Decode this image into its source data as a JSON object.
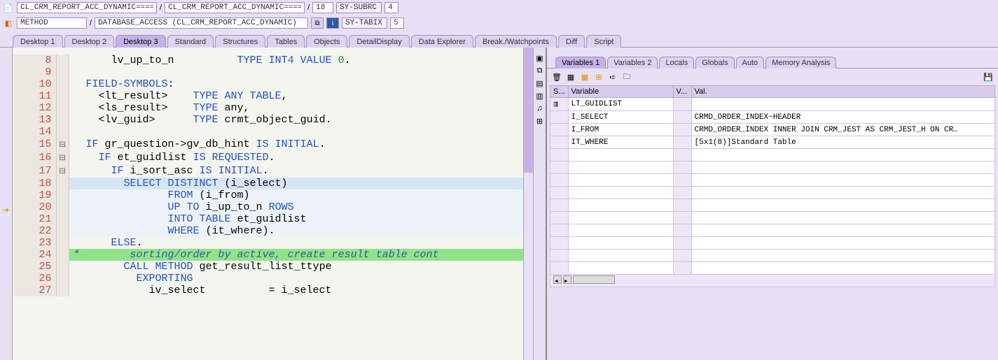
{
  "topbar": {
    "field1": "CL_CRM_REPORT_ACC_DYNAMIC====",
    "slash": "/",
    "field2": "CL_CRM_REPORT_ACC_DYNAMIC====",
    "field3": "18",
    "subrc_label": "SY-SUBRC",
    "subrc_val": "4"
  },
  "secbar": {
    "field1": "METHOD",
    "slash": "/",
    "field2": "DATABASE_ACCESS (CL_CRM_REPORT_ACC_DYNAMIC)",
    "tabix_label": "SY-TABIX",
    "tabix_val": "5"
  },
  "maintabs": [
    {
      "label": "Desktop 1"
    },
    {
      "label": "Desktop 2"
    },
    {
      "label": "Desktop 3",
      "active": true
    },
    {
      "label": "Standard"
    },
    {
      "label": "Structures"
    },
    {
      "label": "Tables"
    },
    {
      "label": "Objects"
    },
    {
      "label": "DetailDisplay"
    },
    {
      "label": "Data Explorer"
    },
    {
      "label": "Break./Watchpoints"
    },
    {
      "label": "Diff"
    },
    {
      "label": "Script"
    }
  ],
  "code": [
    {
      "n": 8,
      "g": "",
      "html": "      lv_up_to_n          <span class='kw'>TYPE</span> <span class='kw'>INT4</span> <span class='kw'>VALUE</span> <span class='num'>0</span>."
    },
    {
      "n": 9,
      "g": "",
      "html": ""
    },
    {
      "n": 10,
      "g": "",
      "html": "  <span class='kw'>FIELD-SYMBOLS</span>:"
    },
    {
      "n": 11,
      "g": "",
      "html": "    &lt;lt_result&gt;    <span class='kw'>TYPE ANY TABLE</span>,"
    },
    {
      "n": 12,
      "g": "",
      "html": "    &lt;ls_result&gt;    <span class='kw'>TYPE</span> any,"
    },
    {
      "n": 13,
      "g": "",
      "html": "    &lt;lv_guid&gt;      <span class='kw'>TYPE</span> crmt_object_guid."
    },
    {
      "n": 14,
      "g": "",
      "html": ""
    },
    {
      "n": 15,
      "g": "⊟",
      "html": "  <span class='kw'>IF</span> gr_question-&gt;gv_db_hint <span class='kw'>IS INITIAL</span>."
    },
    {
      "n": 16,
      "g": "⊟",
      "html": "    <span class='kw'>IF</span> et_guidlist <span class='kw'>IS REQUESTED</span>."
    },
    {
      "n": 17,
      "g": "⊟",
      "html": "      <span class='kw'>IF</span> i_sort_asc <span class='kw'>IS INITIAL</span>."
    },
    {
      "n": 18,
      "g": "",
      "cur": true,
      "html": "        <span class='kw'>SELECT DISTINCT</span> (i_select)"
    },
    {
      "n": 19,
      "g": "",
      "hl": true,
      "html": "               <span class='kw'>FROM</span> (i_from)"
    },
    {
      "n": 20,
      "g": "",
      "hl": true,
      "html": "               <span class='kw'>UP TO</span> i_up_to_n <span class='kw'>ROWS</span>"
    },
    {
      "n": 21,
      "g": "",
      "hl": true,
      "html": "               <span class='kw'>INTO TABLE</span> et_guidlist"
    },
    {
      "n": 22,
      "g": "",
      "hl": true,
      "html": "               <span class='kw'>WHERE</span> (it_where)."
    },
    {
      "n": 23,
      "g": "",
      "html": "      <span class='kw'>ELSE</span>."
    },
    {
      "n": 24,
      "g": "",
      "cmt": true,
      "html": "*        sorting/order by active, create result table cont"
    },
    {
      "n": 25,
      "g": "",
      "html": "        <span class='kw'>CALL METHOD</span> get_result_list_ttype"
    },
    {
      "n": 26,
      "g": "",
      "html": "          <span class='kw'>EXPORTING</span>"
    },
    {
      "n": 27,
      "g": "",
      "html": "            iv_select          = i_select"
    }
  ],
  "var_tabs": [
    {
      "label": "Variables 1",
      "active": true
    },
    {
      "label": "Variables 2"
    },
    {
      "label": "Locals"
    },
    {
      "label": "Globals"
    },
    {
      "label": "Auto"
    },
    {
      "label": "Memory Analysis"
    }
  ],
  "var_headers": {
    "s": "S...",
    "name": "Variable",
    "v": "V...",
    "val": "Val."
  },
  "vars": [
    {
      "s": "⇶",
      "name": "LT_GUIDLIST",
      "v": "",
      "val": ""
    },
    {
      "s": "",
      "name": "I_SELECT",
      "v": "",
      "val": "CRMD_ORDER_INDEX~HEADER"
    },
    {
      "s": "",
      "name": "I_FROM",
      "v": "",
      "val": "CRMD_ORDER_INDEX  INNER JOIN CRM_JEST AS CRM_JEST_H ON CR…"
    },
    {
      "s": "",
      "name": "IT_WHERE",
      "v": "",
      "val": "[5x1(8)]Standard Table"
    }
  ]
}
